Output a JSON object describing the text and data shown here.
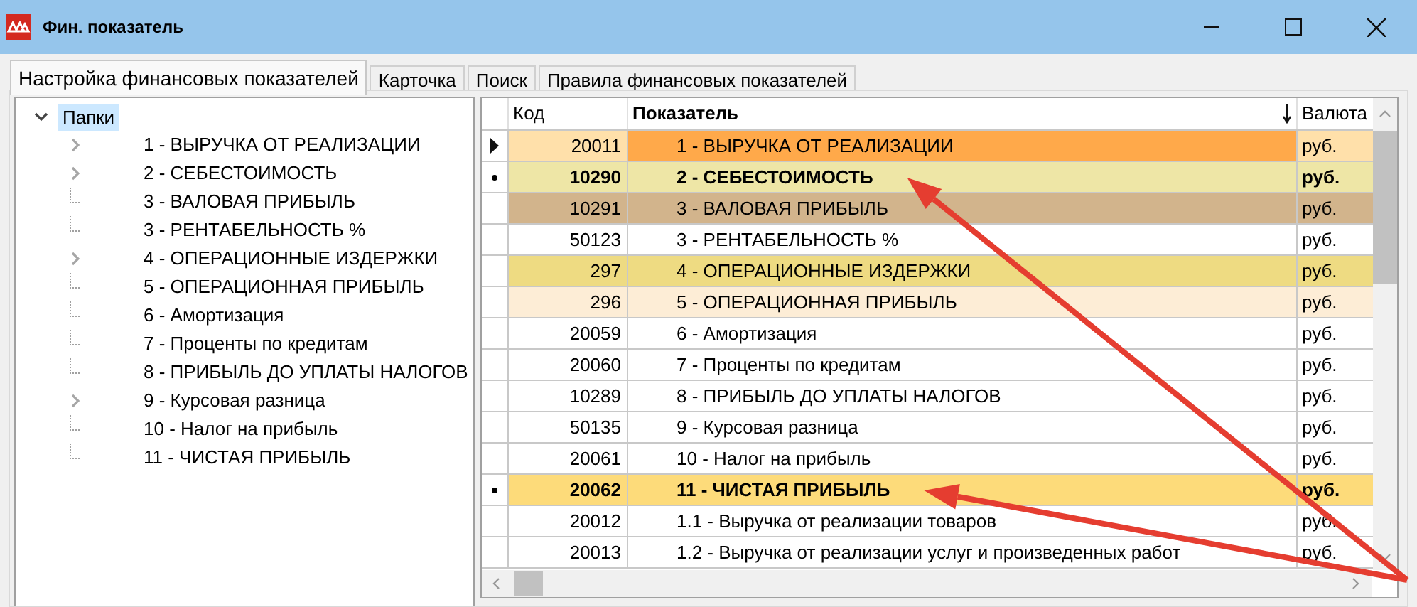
{
  "window": {
    "title": "Фин. показатель"
  },
  "tabs": [
    {
      "label": "Настройка финансовых показателей",
      "selected": true
    },
    {
      "label": "Карточка",
      "selected": false
    },
    {
      "label": "Поиск",
      "selected": false
    },
    {
      "label": "Правила финансовых показателей",
      "selected": false
    }
  ],
  "tree": {
    "label": "Папки",
    "expanded": true,
    "selected": true,
    "children": [
      {
        "label": "1 - ВЫРУЧКА ОТ РЕАЛИЗАЦИИ",
        "expandable": true
      },
      {
        "label": "2 - СЕБЕСТОИМОСТЬ",
        "expandable": true
      },
      {
        "label": "3 - ВАЛОВАЯ ПРИБЫЛЬ",
        "expandable": false
      },
      {
        "label": "3 - РЕНТАБЕЛЬНОСТЬ %",
        "expandable": false
      },
      {
        "label": "4 - ОПЕРАЦИОННЫЕ ИЗДЕРЖКИ",
        "expandable": true
      },
      {
        "label": "5 - ОПЕРАЦИОННАЯ ПРИБЫЛЬ",
        "expandable": false
      },
      {
        "label": "6 - Амортизация",
        "expandable": false
      },
      {
        "label": "7 - Проценты по кредитам",
        "expandable": false
      },
      {
        "label": "8 - ПРИБЫЛЬ ДО УПЛАТЫ НАЛОГОВ",
        "expandable": false
      },
      {
        "label": "9 - Курсовая разница",
        "expandable": true
      },
      {
        "label": "10 - Налог на прибыль",
        "expandable": false
      },
      {
        "label": "11 - ЧИСТАЯ ПРИБЫЛЬ",
        "expandable": false
      }
    ]
  },
  "table": {
    "columns": [
      "Код",
      "Показатель",
      "Валюта"
    ],
    "rows": [
      {
        "current": true,
        "dot": false,
        "annotated": false,
        "code": "20011",
        "name": "1 - ВЫРУЧКА ОТ РЕАЛИЗАЦИИ",
        "currency": "руб.",
        "color": "#ffe0aa",
        "highlight": {
          "color": "#ffa94a"
        },
        "bold": false
      },
      {
        "current": false,
        "dot": true,
        "annotated": true,
        "code": "10290",
        "name": "2 - СЕБЕСТОИМОСТЬ",
        "currency": "руб.",
        "color": "#eee6a6",
        "bold": true
      },
      {
        "current": false,
        "dot": false,
        "annotated": false,
        "code": "10291",
        "name": "3 - ВАЛОВАЯ ПРИБЫЛЬ",
        "currency": "руб.",
        "color": "#d2b48c",
        "bold": false
      },
      {
        "current": false,
        "dot": false,
        "annotated": false,
        "code": "50123",
        "name": "3 - РЕНТАБЕЛЬНОСТЬ %",
        "currency": "руб.",
        "color": "#ffffff",
        "bold": false
      },
      {
        "current": false,
        "dot": false,
        "annotated": false,
        "code": "297",
        "name": "4 - ОПЕРАЦИОННЫЕ ИЗДЕРЖКИ",
        "currency": "руб.",
        "color": "#eedb82",
        "bold": false
      },
      {
        "current": false,
        "dot": false,
        "annotated": false,
        "code": "296",
        "name": "5 - ОПЕРАЦИОННАЯ ПРИБЫЛЬ",
        "currency": "руб.",
        "color": "#fdedd6",
        "bold": false
      },
      {
        "current": false,
        "dot": false,
        "annotated": false,
        "code": "20059",
        "name": "6 - Амортизация",
        "currency": "руб.",
        "color": "#ffffff",
        "bold": false
      },
      {
        "current": false,
        "dot": false,
        "annotated": false,
        "code": "20060",
        "name": "7 - Проценты по кредитам",
        "currency": "руб.",
        "color": "#ffffff",
        "bold": false
      },
      {
        "current": false,
        "dot": false,
        "annotated": false,
        "code": "10289",
        "name": "8 - ПРИБЫЛЬ ДО УПЛАТЫ НАЛОГОВ",
        "currency": "руб.",
        "color": "#ffffff",
        "bold": false
      },
      {
        "current": false,
        "dot": false,
        "annotated": false,
        "code": "50135",
        "name": "9 - Курсовая разница",
        "currency": "руб.",
        "color": "#ffffff",
        "bold": false
      },
      {
        "current": false,
        "dot": false,
        "annotated": false,
        "code": "20061",
        "name": "10 - Налог на прибыль",
        "currency": "руб.",
        "color": "#ffffff",
        "bold": false
      },
      {
        "current": false,
        "dot": true,
        "annotated": true,
        "code": "20062",
        "name": "11 - ЧИСТАЯ ПРИБЫЛЬ",
        "currency": "руб.",
        "color": "#fddb7a",
        "bold": true
      },
      {
        "current": false,
        "dot": false,
        "annotated": false,
        "code": "20012",
        "name": "1.1 - Выручка от реализации товаров",
        "currency": "руб.",
        "color": "#ffffff",
        "bold": false
      },
      {
        "current": false,
        "dot": false,
        "annotated": false,
        "code": "20013",
        "name": "1.2 - Выручка от реализации услуг и произведенных работ",
        "currency": "руб.",
        "color": "#ffffff",
        "bold": false
      }
    ]
  }
}
